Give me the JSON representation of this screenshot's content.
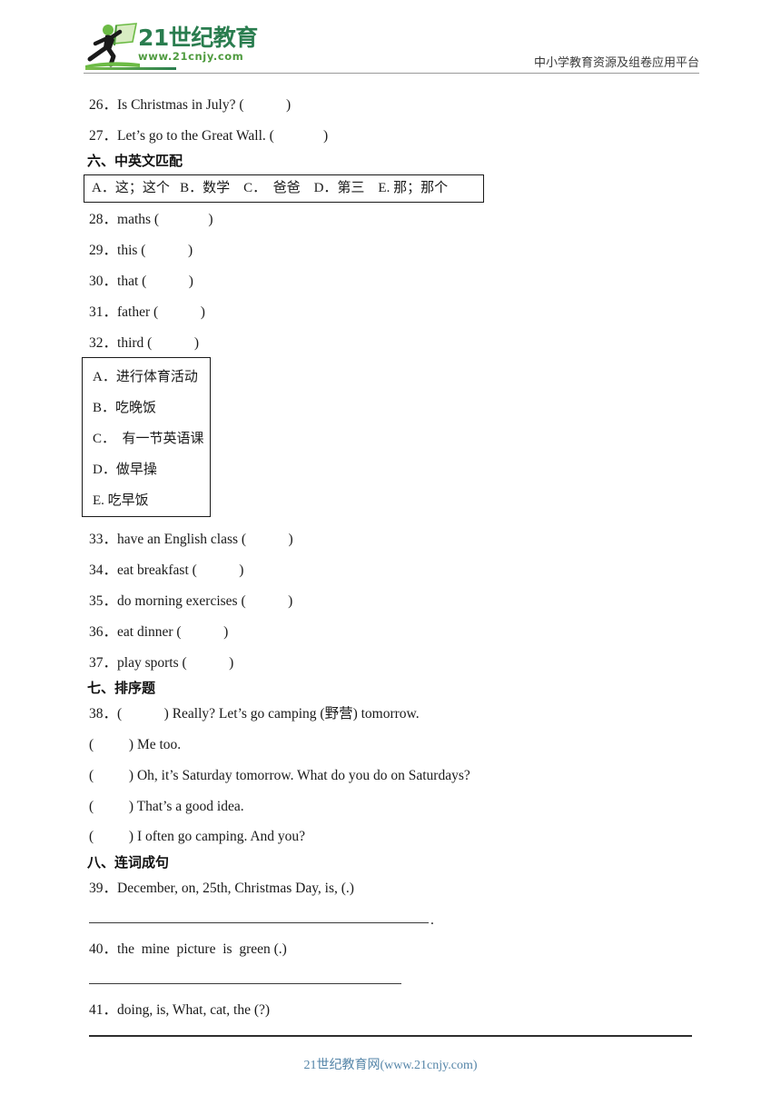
{
  "header": {
    "logo_main": "21世纪教育",
    "logo_number": "21",
    "logo_cn": "世纪教育",
    "logo_url": "www.21cnjy.com",
    "tagline": "中小学教育资源及组卷应用平台",
    "brand_green_dark": "#2a7d4f",
    "brand_green_light": "#6cbb45"
  },
  "questions_top": [
    {
      "num": "26．",
      "text": "Is Christmas in July? (            )"
    },
    {
      "num": "27．",
      "text": "Let’s go to the Great Wall. (              )"
    }
  ],
  "section_six": {
    "title": "六、中英文匹配",
    "options_inline": "A．这；这个   B．数学    C．  爸爸    D．第三    E. 那；那个",
    "items": [
      {
        "num": "28．",
        "text": "maths (              )"
      },
      {
        "num": "29．",
        "text": "this (            )"
      },
      {
        "num": "30．",
        "text": "that (            )"
      },
      {
        "num": "31．",
        "text": "father (            )"
      },
      {
        "num": "32．",
        "text": "third (            )"
      }
    ]
  },
  "option_box_vertical": [
    "A．进行体育活动",
    "B．吃晚饭",
    "C．  有一节英语课",
    "D．做早操",
    "E. 吃早饭"
  ],
  "questions_matching": [
    {
      "num": "33．",
      "text": "have an English class (            )"
    },
    {
      "num": "34．",
      "text": "eat breakfast (            )"
    },
    {
      "num": "35．",
      "text": "do morning exercises (            )"
    },
    {
      "num": "36．",
      "text": "eat dinner (            )"
    },
    {
      "num": "37．",
      "text": "play sports (            )"
    }
  ],
  "section_seven": {
    "title": "七、排序题",
    "items": [
      {
        "num": "38．",
        "text": "(            ) Really? Let’s go camping (野营) tomorrow."
      },
      {
        "num": "",
        "text": "(          ) Me too."
      },
      {
        "num": "",
        "text": "(          ) Oh, it’s Saturday tomorrow. What do you do on Saturdays?"
      },
      {
        "num": "",
        "text": "(          ) That’s a good idea."
      },
      {
        "num": "",
        "text": "(          ) I often go camping. And you?"
      }
    ]
  },
  "section_eight": {
    "title": "八、连词成句",
    "items": [
      {
        "num": "39．",
        "text": "December, on, 25th, Christmas Day, is, (.)",
        "trailing_mark": "."
      },
      {
        "num": "40．",
        "text": "the  mine  picture  is  green (.)",
        "trailing_mark": ""
      },
      {
        "num": "41．",
        "text": "doing, is, What, cat, the (?)",
        "trailing_mark": ""
      }
    ]
  },
  "footer": {
    "text": "21世纪教育网(www.21cnjy.com)",
    "color": "#5585a8"
  }
}
